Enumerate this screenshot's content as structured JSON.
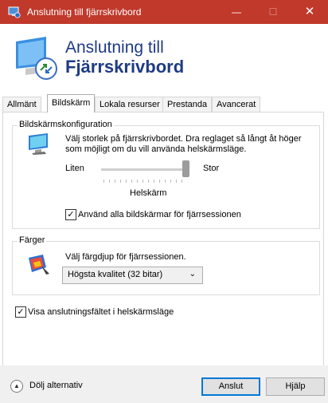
{
  "window": {
    "title": "Anslutning till fjärrskrivbord",
    "controls": {
      "minimize": "—",
      "maximize": "☐",
      "close": "✕"
    }
  },
  "header": {
    "line1": "Anslutning till",
    "line2": "Fjärrskrivbord"
  },
  "tabs": [
    {
      "label": "Allmänt"
    },
    {
      "label": "Bildskärm",
      "active": true
    },
    {
      "label": "Lokala resurser"
    },
    {
      "label": "Prestanda"
    },
    {
      "label": "Avancerat"
    }
  ],
  "display_group": {
    "legend": "Bildskärmskonfiguration",
    "description": "Välj storlek på fjärrskrivbordet. Dra reglaget så långt åt höger som möjligt om du vill använda helskärmsläge.",
    "slider": {
      "min_label": "Liten",
      "max_label": "Stor",
      "value_label": "Helskärm",
      "level_fraction": 1.0
    },
    "use_all_monitors": {
      "label": "Använd alla bildskärmar för fjärrsessionen",
      "checked": true
    }
  },
  "colors_group": {
    "legend": "Färger",
    "description": "Välj färgdjup för fjärrsessionen.",
    "depth_select": {
      "selected": "Högsta kvalitet (32 bitar)"
    }
  },
  "show_connection_bar": {
    "label": "Visa anslutningsfältet i helskärmsläge",
    "checked": true
  },
  "footer": {
    "hide_options": "Dölj alternativ",
    "connect_button": "Anslut",
    "help_button": "Hjälp"
  },
  "icons": {
    "app": "remote-desktop-icon",
    "display": "monitor-icon",
    "colors": "color-palette-icon",
    "hide": "chevron-up-circle-icon"
  },
  "colors": {
    "titlebar": "#c0392b",
    "heading": "#1f3b84",
    "accent": "#0078d7"
  }
}
